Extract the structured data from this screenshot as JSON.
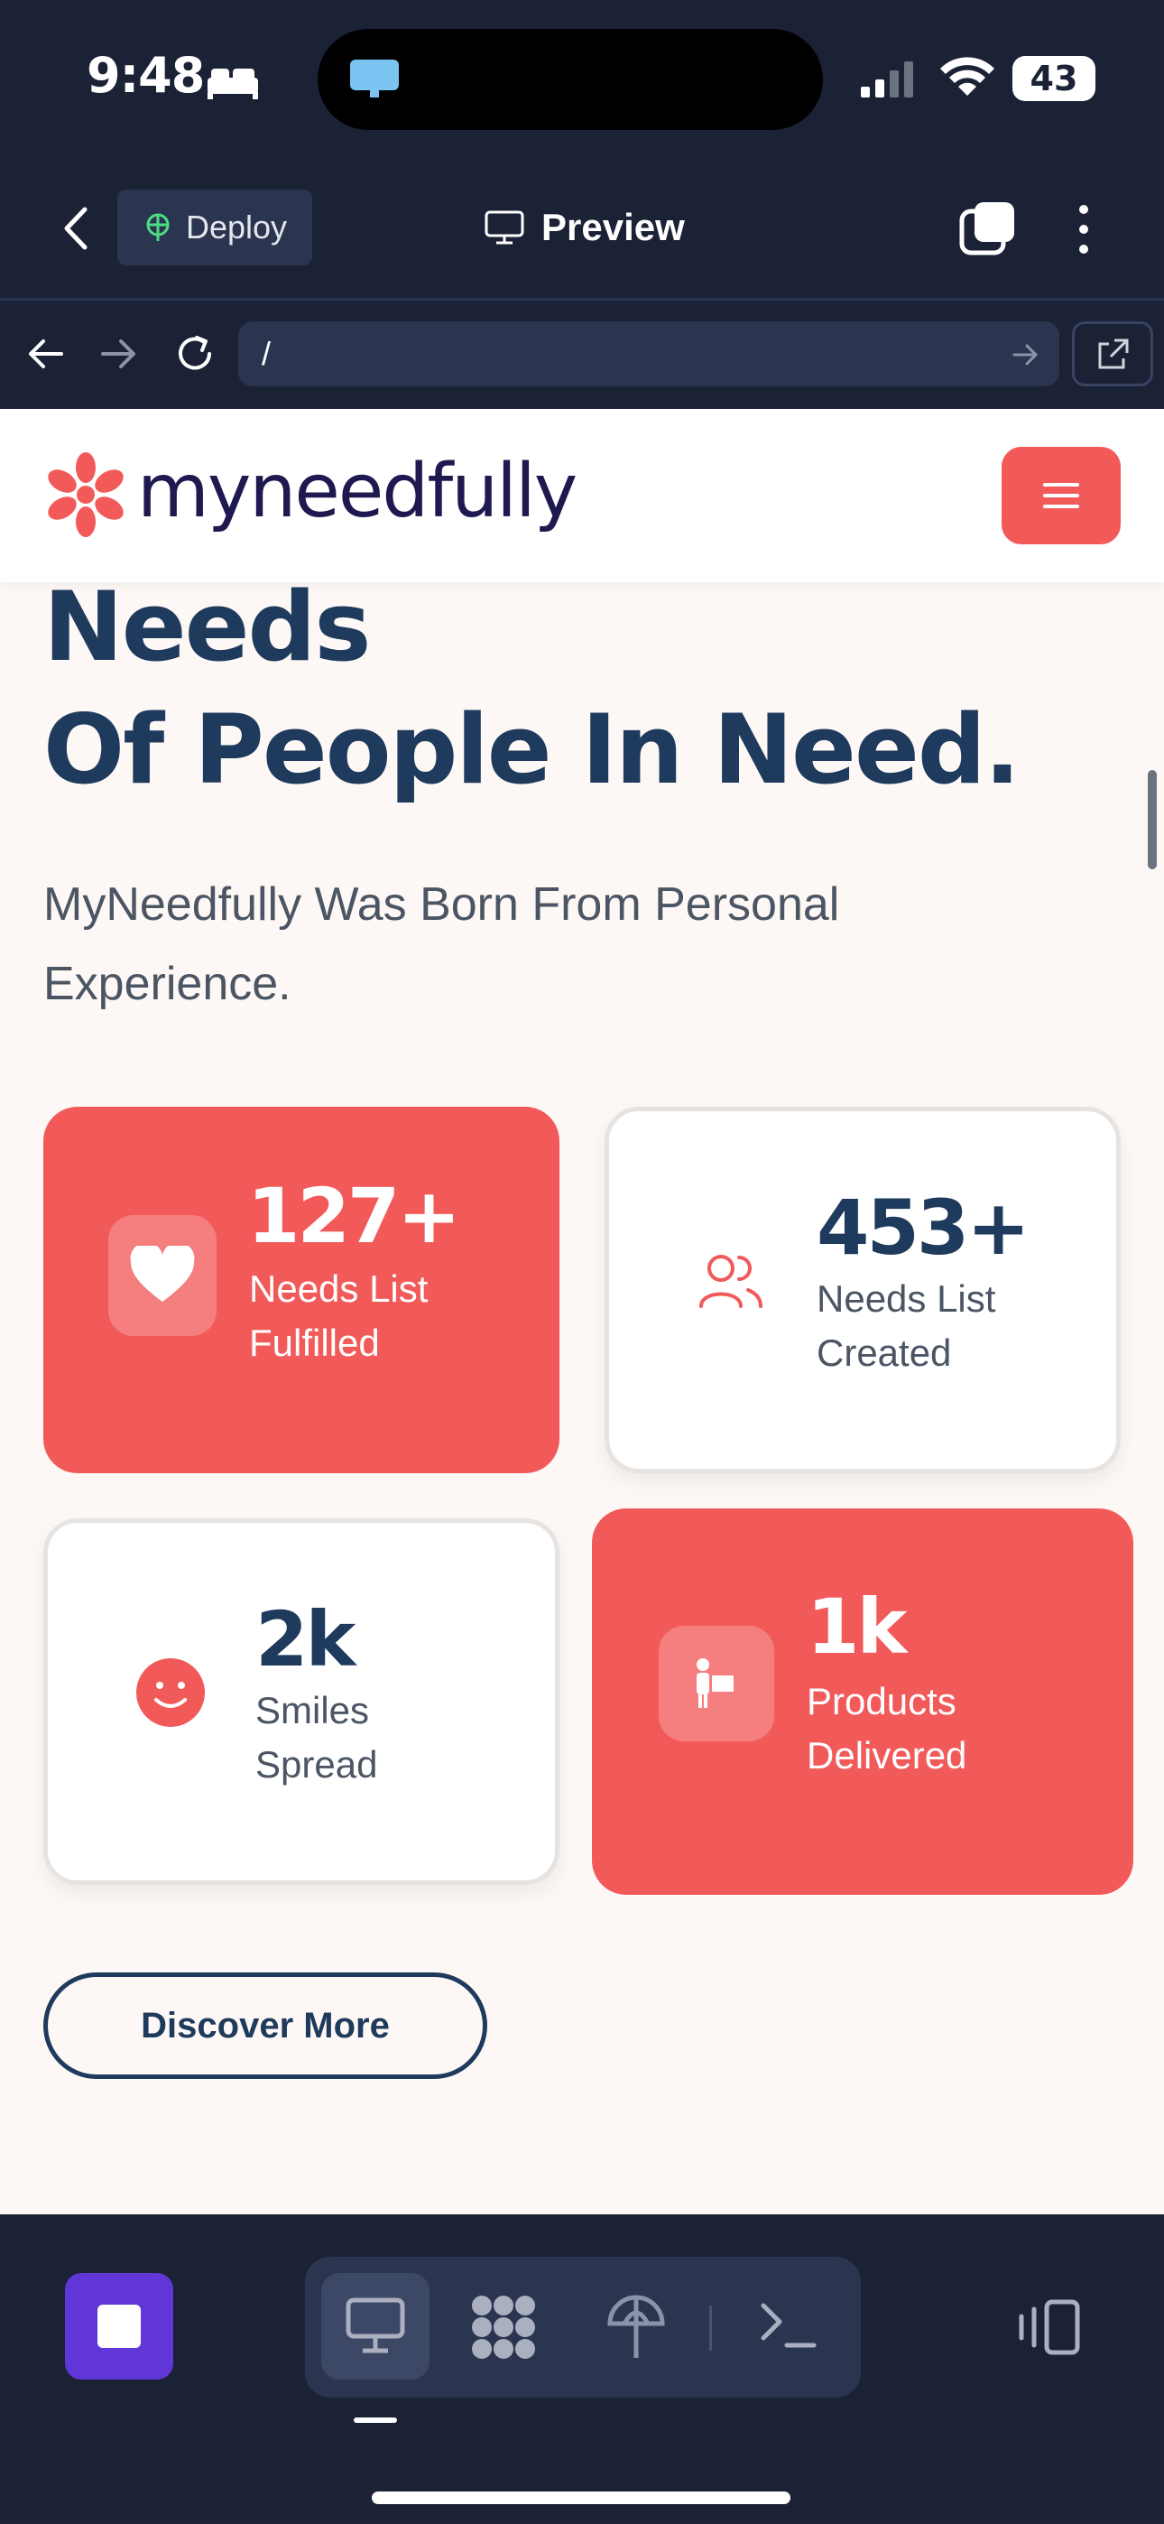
{
  "status_bar": {
    "time": "9:48",
    "battery": "43"
  },
  "app_header": {
    "deploy_label": "Deploy",
    "preview_label": "Preview"
  },
  "url_bar": {
    "url": "/"
  },
  "site": {
    "logo_text": "myneedfully",
    "hero_lines": [
      "Needs",
      "Of People In Need."
    ],
    "subtitle": "MyNeedfully Was Born From Personal Experience.",
    "stats": [
      {
        "number": "127+",
        "label": "Needs List Fulfilled",
        "icon": "heart-icon"
      },
      {
        "number": "453+",
        "label": "Needs List Created",
        "icon": "users-icon"
      },
      {
        "number": "2k",
        "label": "Smiles Spread",
        "icon": "smile-icon"
      },
      {
        "number": "1k",
        "label": "Products Delivered",
        "icon": "delivery-icon"
      }
    ],
    "cta_label": "Discover More",
    "colors": {
      "accent": "#f25a5a",
      "navy": "#1e3a5c",
      "background": "#fdf8f5"
    }
  },
  "bottom_toolbar": {
    "tabs": [
      "preview-tab",
      "apps-tab",
      "deploy-tab",
      "shell-tab"
    ]
  }
}
